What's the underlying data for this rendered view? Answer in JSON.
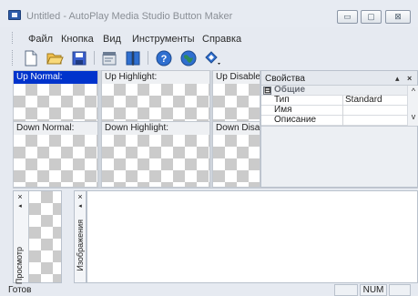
{
  "window": {
    "title": "Untitled - AutoPlay Media Studio Button Maker",
    "controls": {
      "minimize": "▭",
      "maximize": "▢",
      "close": "⊠"
    }
  },
  "menu": [
    "Файл",
    "Кнопка",
    "Вид",
    "Инструменты",
    "Справка"
  ],
  "toolbar": [
    {
      "icon": "new-document-icon",
      "color": "#ffffff"
    },
    {
      "icon": "open-folder-icon",
      "color": "#f2c14e"
    },
    {
      "icon": "save-disk-icon",
      "color": "#3a5fcd"
    },
    {
      "icon": "properties-icon",
      "color": "#6b7c93"
    },
    {
      "icon": "split-columns-icon",
      "color": "#2f6fd0"
    },
    {
      "icon": "help-icon",
      "color": "#2f6fd0"
    },
    {
      "icon": "web-globe-icon",
      "color": "#2e8b57"
    },
    {
      "icon": "diamond-dropdown-icon",
      "color": "#2f6fd0"
    }
  ],
  "states": [
    {
      "label": "Up Normal:",
      "selected": true
    },
    {
      "label": "Up Highlight:",
      "selected": false
    },
    {
      "label": "Up Disabled:",
      "selected": false
    },
    {
      "label": "Down Normal:",
      "selected": false
    },
    {
      "label": "Down Highlight:",
      "selected": false
    },
    {
      "label": "Down Disabled:",
      "selected": false
    }
  ],
  "properties": {
    "title": "Свойства",
    "controls": {
      "pin": "▴",
      "close": "×"
    },
    "category": {
      "toggle": "⊟",
      "label": "Общие"
    },
    "rows": [
      {
        "key": "Тип",
        "value": "Standard"
      },
      {
        "key": "Имя",
        "value": ""
      },
      {
        "key": "Описание",
        "value": ""
      }
    ]
  },
  "panels": {
    "preview": {
      "label": "Просмотр",
      "close": "×",
      "arrow": "◂"
    },
    "images": {
      "label": "Изображения",
      "close": "×",
      "arrow": "◂"
    }
  },
  "status": {
    "text": "Готов",
    "num": "NUM"
  },
  "colors": {
    "selection": "#0033cc",
    "chrome": "#e6eaf1"
  }
}
